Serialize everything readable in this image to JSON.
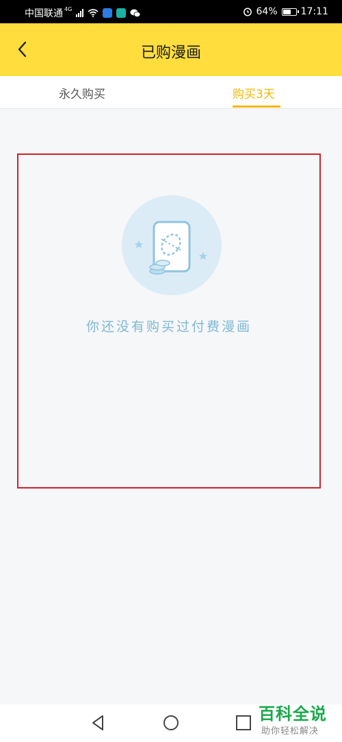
{
  "status_bar": {
    "carrier": "中国联通",
    "network": "4G",
    "battery": "64%",
    "battery_level": 0.64,
    "time": "17:11",
    "icons": [
      "signal-icon",
      "wifi-icon",
      "shield-app-icon",
      "cat-app-icon",
      "wechat-icon",
      "alarm-icon",
      "battery-icon"
    ]
  },
  "header": {
    "title": "已购漫画",
    "back_icon": "chevron-left-icon",
    "background": "#fedd3c"
  },
  "tabs": [
    {
      "label": "永久购买",
      "active": false
    },
    {
      "label": "购买3天",
      "active": true
    }
  ],
  "accent_color": "#f2b800",
  "empty_state": {
    "message": "你还没有购买过付费漫画",
    "illustration": "comic-card-with-coins-icon",
    "highlight_color": "#d0202a"
  },
  "nav_bar": {
    "icons": [
      "nav-back-icon",
      "nav-home-icon",
      "nav-recent-icon"
    ]
  },
  "watermark": {
    "title": "百科全说",
    "subtitle": "助你轻松解决"
  }
}
